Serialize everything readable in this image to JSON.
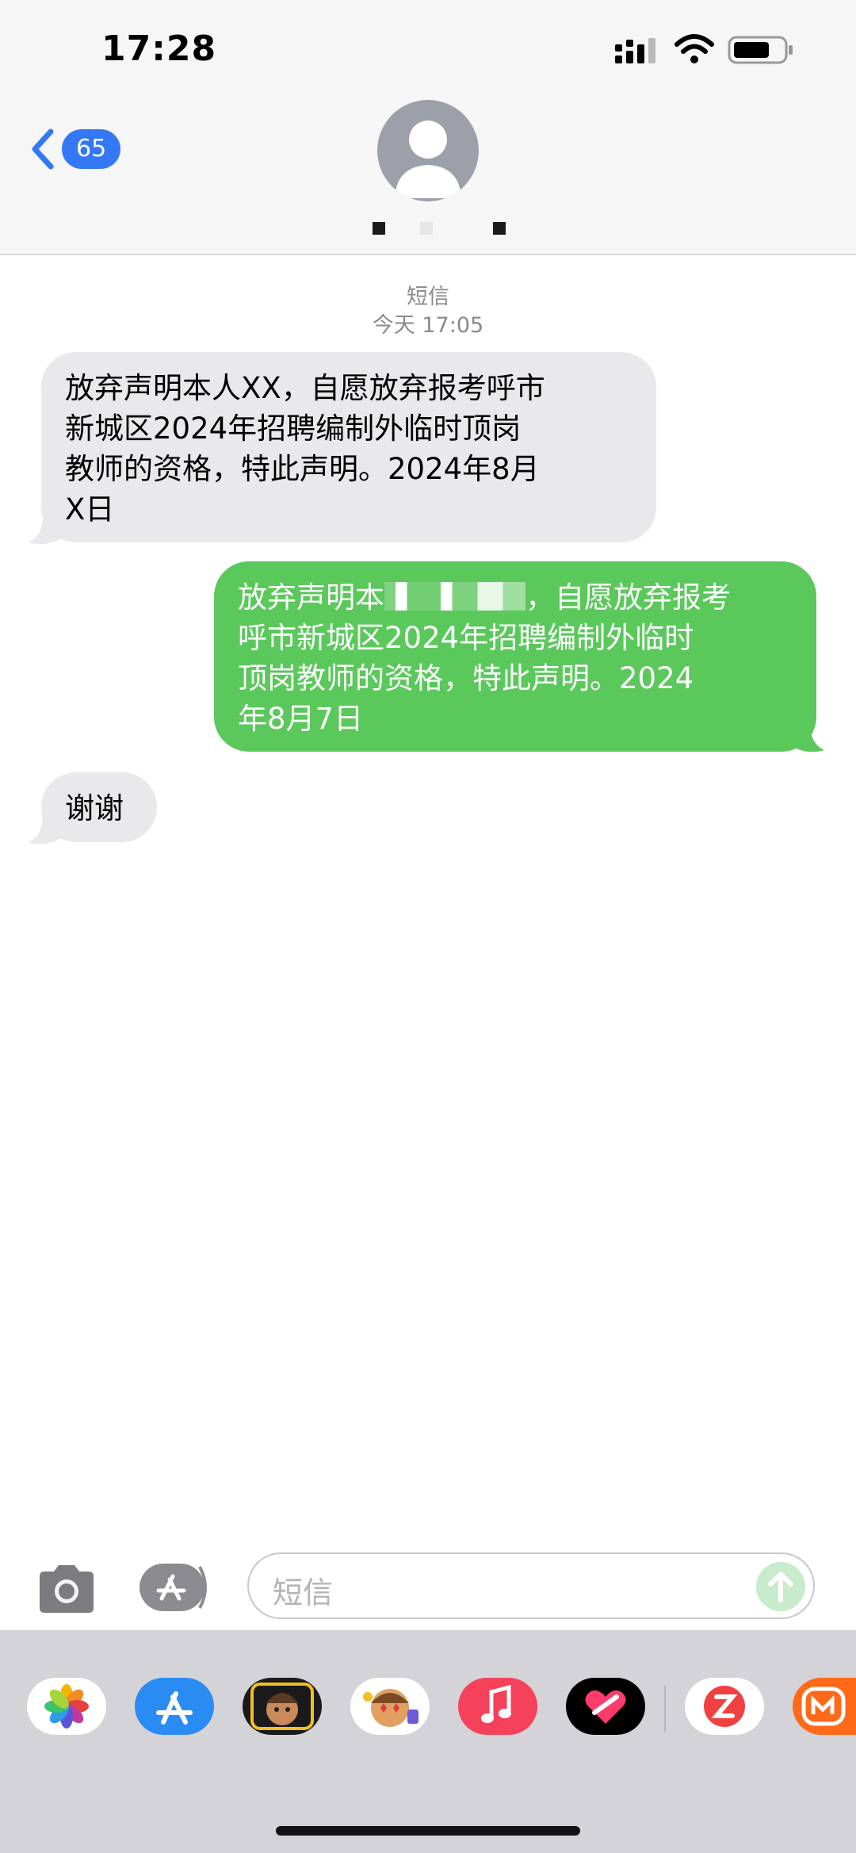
{
  "status": {
    "time": "17:28"
  },
  "header": {
    "back_count": "65"
  },
  "conversation": {
    "service": "短信",
    "timestamp": "今天 17:05",
    "messages": [
      {
        "direction": "incoming",
        "lines": [
          "放弃声明本人XX，自愿放弃报考呼市",
          "新城区2024年招聘编制外临时顶岗",
          "教师的资格，特此声明。2024年8月",
          "X日"
        ]
      },
      {
        "direction": "outgoing",
        "lines": [
          "放弃声明本",
          "，自愿放弃报考",
          "呼市新城区2024年招聘编制外临时",
          "顶岗教师的资格，特此声明。2024",
          "年8月7日"
        ]
      },
      {
        "direction": "incoming",
        "lines": [
          "谢谢"
        ]
      }
    ]
  },
  "composer": {
    "placeholder": "短信"
  },
  "app_drawer": {
    "apps": [
      "photos-app",
      "app-store",
      "memoji-stickers",
      "animoji",
      "music-app",
      "fitness-app",
      "zhihu-app",
      "mango-tv-app"
    ]
  },
  "colors": {
    "incoming_bubble": "#e9e9eb",
    "outgoing_bubble": "#5bc85c",
    "accent": "#3478f6"
  }
}
